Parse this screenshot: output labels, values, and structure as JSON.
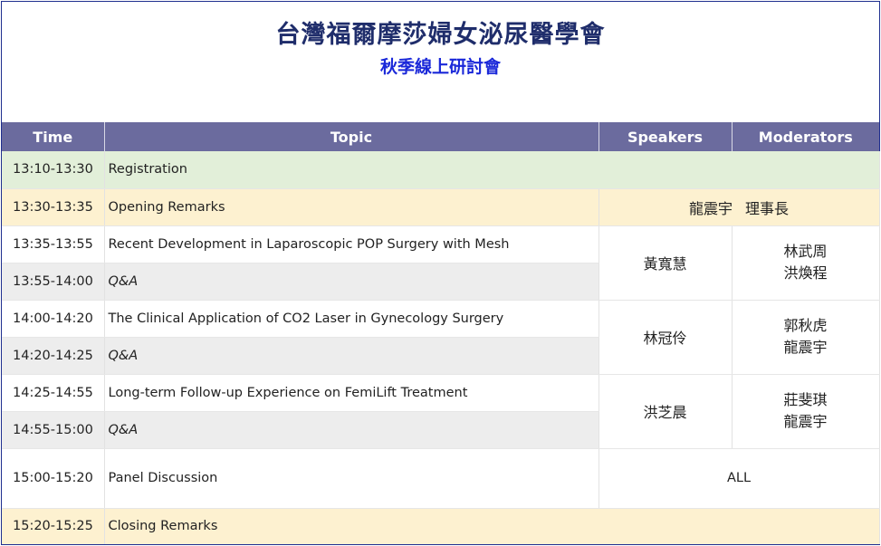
{
  "header": {
    "title": "台灣福爾摩莎婦女泌尿醫學會",
    "subtitle": "秋季線上研討會"
  },
  "columns": {
    "time": "Time",
    "topic": "Topic",
    "speakers": "Speakers",
    "moderators": "Moderators"
  },
  "rows": [
    {
      "time": "13:10-13:30",
      "topic": "Registration"
    },
    {
      "time": "13:30-13:35",
      "topic": "Opening Remarks",
      "speaker": "龍震宇",
      "speaker_title": "理事長"
    },
    {
      "time": "13:35-13:55",
      "topic": "Recent Development in Laparoscopic POP Surgery with Mesh"
    },
    {
      "time": "13:55-14:00",
      "topic": "Q&A"
    },
    {
      "time": "14:00-14:20",
      "topic": "The Clinical Application of CO2 Laser in Gynecology Surgery"
    },
    {
      "time": "14:20-14:25",
      "topic": "Q&A"
    },
    {
      "time": "14:25-14:55",
      "topic": "Long-term Follow-up Experience on FemiLift Treatment"
    },
    {
      "time": "14:55-15:00",
      "topic": "Q&A"
    },
    {
      "time": "15:00-15:20",
      "topic": "Panel Discussion",
      "speaker": "ALL"
    },
    {
      "time": "15:20-15:25",
      "topic": "Closing Remarks"
    }
  ],
  "sessions": [
    {
      "speaker": "黃寬慧",
      "moderators": [
        "林武周",
        "洪煥程"
      ]
    },
    {
      "speaker": "林冠伶",
      "moderators": [
        "郭秋虎",
        "龍震宇"
      ]
    },
    {
      "speaker": "洪芝晨",
      "moderators": [
        "莊斐琪",
        "龍震宇"
      ]
    }
  ],
  "colors": {
    "header_bg": "#6b6b9e",
    "title": "#1f2d6b",
    "subtitle": "#1a28d9",
    "registration_bg": "#e2efd9",
    "remarks_bg": "#fdf1d0",
    "qa_bg": "#ededed"
  }
}
